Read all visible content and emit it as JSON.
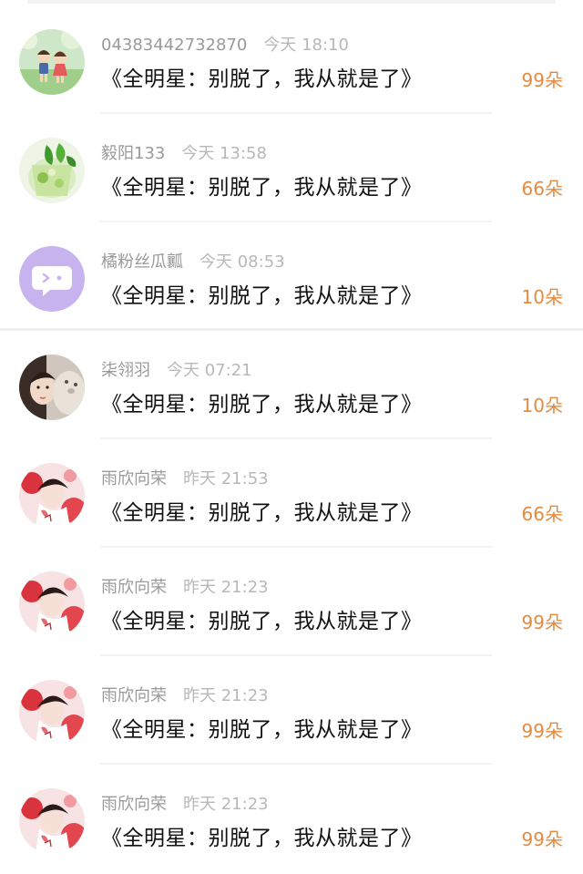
{
  "accent_color": "#e68a3e",
  "comments": [
    {
      "user": "04383442732870",
      "time": "今天 18:10",
      "text": "《全明星：别脱了，我从就是了》",
      "flowers": "99朵",
      "avatar_icon": "cartoon-kids-avatar-icon"
    },
    {
      "user": "毅阳133",
      "time": "今天 13:58",
      "text": "《全明星：别脱了，我从就是了》",
      "flowers": "66朵",
      "avatar_icon": "lime-drink-avatar-icon"
    },
    {
      "user": "橘粉丝瓜瓤",
      "time": "今天 08:53",
      "text": "《全明星：别脱了，我从就是了》",
      "flowers": "10朵",
      "avatar_icon": "chat-bubble-avatar-icon"
    },
    {
      "user": "柒翎羽",
      "time": "今天 07:21",
      "text": "《全明星：别脱了，我从就是了》",
      "flowers": "10朵",
      "avatar_icon": "girl-with-plush-avatar-icon"
    },
    {
      "user": "雨欣向荣",
      "time": "昨天 21:53",
      "text": "《全明星：别脱了，我从就是了》",
      "flowers": "66朵",
      "avatar_icon": "girl-red-flower-avatar-icon"
    },
    {
      "user": "雨欣向荣",
      "time": "昨天 21:23",
      "text": "《全明星：别脱了，我从就是了》",
      "flowers": "99朵",
      "avatar_icon": "girl-red-flower-avatar-icon"
    },
    {
      "user": "雨欣向荣",
      "time": "昨天 21:23",
      "text": "《全明星：别脱了，我从就是了》",
      "flowers": "99朵",
      "avatar_icon": "girl-red-flower-avatar-icon"
    },
    {
      "user": "雨欣向荣",
      "time": "昨天 21:23",
      "text": "《全明星：别脱了，我从就是了》",
      "flowers": "99朵",
      "avatar_icon": "girl-red-flower-avatar-icon"
    }
  ]
}
